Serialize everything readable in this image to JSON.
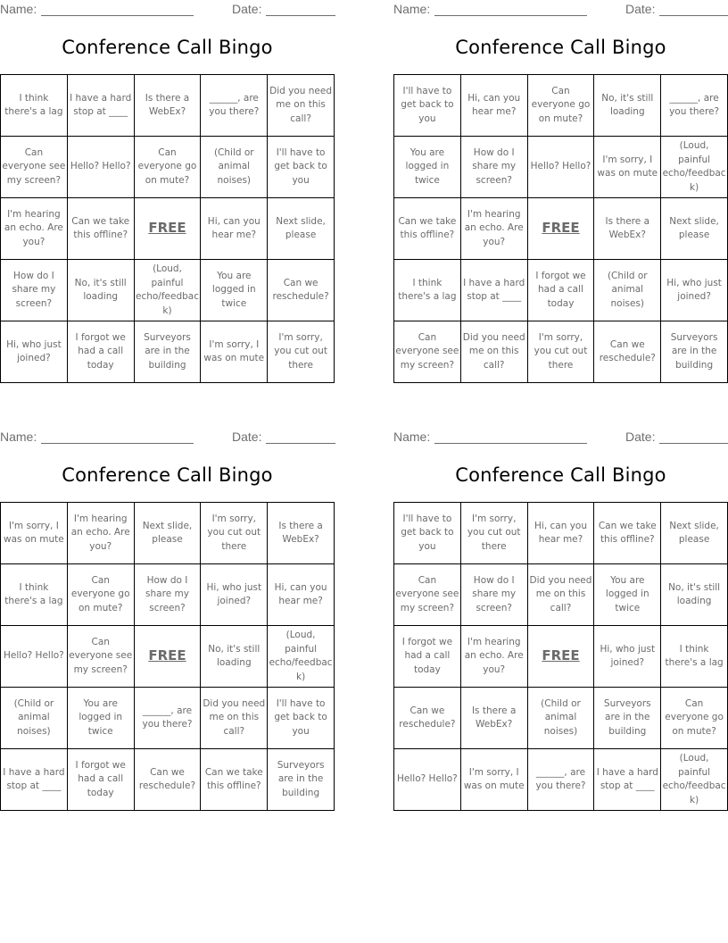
{
  "header": {
    "name_label": "Name:",
    "date_label": "Date:"
  },
  "title": "Conference Call Bingo",
  "free_label": "FREE",
  "cards": [
    {
      "rows": [
        [
          "I think there's a lag",
          "I have a hard stop at ____",
          "Is there a WebEx?",
          "______, are you there?",
          "Did you need me on this call?"
        ],
        [
          "Can everyone see my screen?",
          "Hello? Hello?",
          "Can everyone go on mute?",
          "(Child or animal noises)",
          "I'll have to get back to you"
        ],
        [
          "I'm hearing an echo. Are you?",
          "Can we take this offline?",
          "FREE",
          "Hi, can you hear me?",
          "Next slide, please"
        ],
        [
          "How do I share my screen?",
          "No, it's still loading",
          "(Loud, painful echo/feedback)",
          "You are logged in twice",
          "Can we reschedule?"
        ],
        [
          "Hi, who just joined?",
          "I forgot we had a call today",
          "Surveyors are in the building",
          "I'm sorry, I was on mute",
          "I'm sorry, you cut out there"
        ]
      ]
    },
    {
      "rows": [
        [
          "I'll have to get back to you",
          "Hi, can you hear me?",
          "Can everyone go on mute?",
          "No, it's still loading",
          "______, are you there?"
        ],
        [
          "You are logged in twice",
          "How do I share my screen?",
          "Hello? Hello?",
          "I'm sorry, I was on mute",
          "(Loud, painful echo/feedback)"
        ],
        [
          "Can we take this offline?",
          "I'm hearing an echo. Are you?",
          "FREE",
          "Is there a WebEx?",
          "Next slide, please"
        ],
        [
          "I think there's a lag",
          "I have a hard stop at ____",
          "I forgot we had a call today",
          "(Child or animal noises)",
          "Hi, who just joined?"
        ],
        [
          "Can everyone see my screen?",
          "Did you need me on this call?",
          "I'm sorry, you cut out there",
          "Can we reschedule?",
          "Surveyors are in the building"
        ]
      ]
    },
    {
      "rows": [
        [
          "I'm sorry, I was on mute",
          "I'm hearing an echo. Are you?",
          "Next slide, please",
          "I'm sorry, you cut out there",
          "Is there a WebEx?"
        ],
        [
          "I think there's a lag",
          "Can everyone go on mute?",
          "How do I share my screen?",
          "Hi, who just joined?",
          "Hi, can you hear me?"
        ],
        [
          "Hello? Hello?",
          "Can everyone see my screen?",
          "FREE",
          "No, it's still loading",
          "(Loud, painful echo/feedback)"
        ],
        [
          "(Child or animal noises)",
          "You are logged in twice",
          "______, are you there?",
          "Did you need me on this call?",
          "I'll have to get back to you"
        ],
        [
          "I have a hard stop at ____",
          "I forgot we had a call today",
          "Can we reschedule?",
          "Can we take this offline?",
          "Surveyors are in the building"
        ]
      ]
    },
    {
      "rows": [
        [
          "I'll have to get back to you",
          "I'm sorry, you cut out there",
          "Hi, can you hear me?",
          "Can we take this offline?",
          "Next slide, please"
        ],
        [
          "Can everyone see my screen?",
          "How do I share my screen?",
          "Did you need me on this call?",
          "You are logged in twice",
          "No, it's still loading"
        ],
        [
          "I forgot we had a call today",
          "I'm hearing an echo. Are you?",
          "FREE",
          "Hi, who just joined?",
          "I think there's a lag"
        ],
        [
          "Can we reschedule?",
          "Is there a WebEx?",
          "(Child or animal noises)",
          "Surveyors are in the building",
          "Can everyone go on mute?"
        ],
        [
          "Hello? Hello?",
          "I'm sorry, I was on mute",
          "______, are you there?",
          "I have a hard stop at ____",
          "(Loud, painful echo/feedback)"
        ]
      ]
    }
  ]
}
